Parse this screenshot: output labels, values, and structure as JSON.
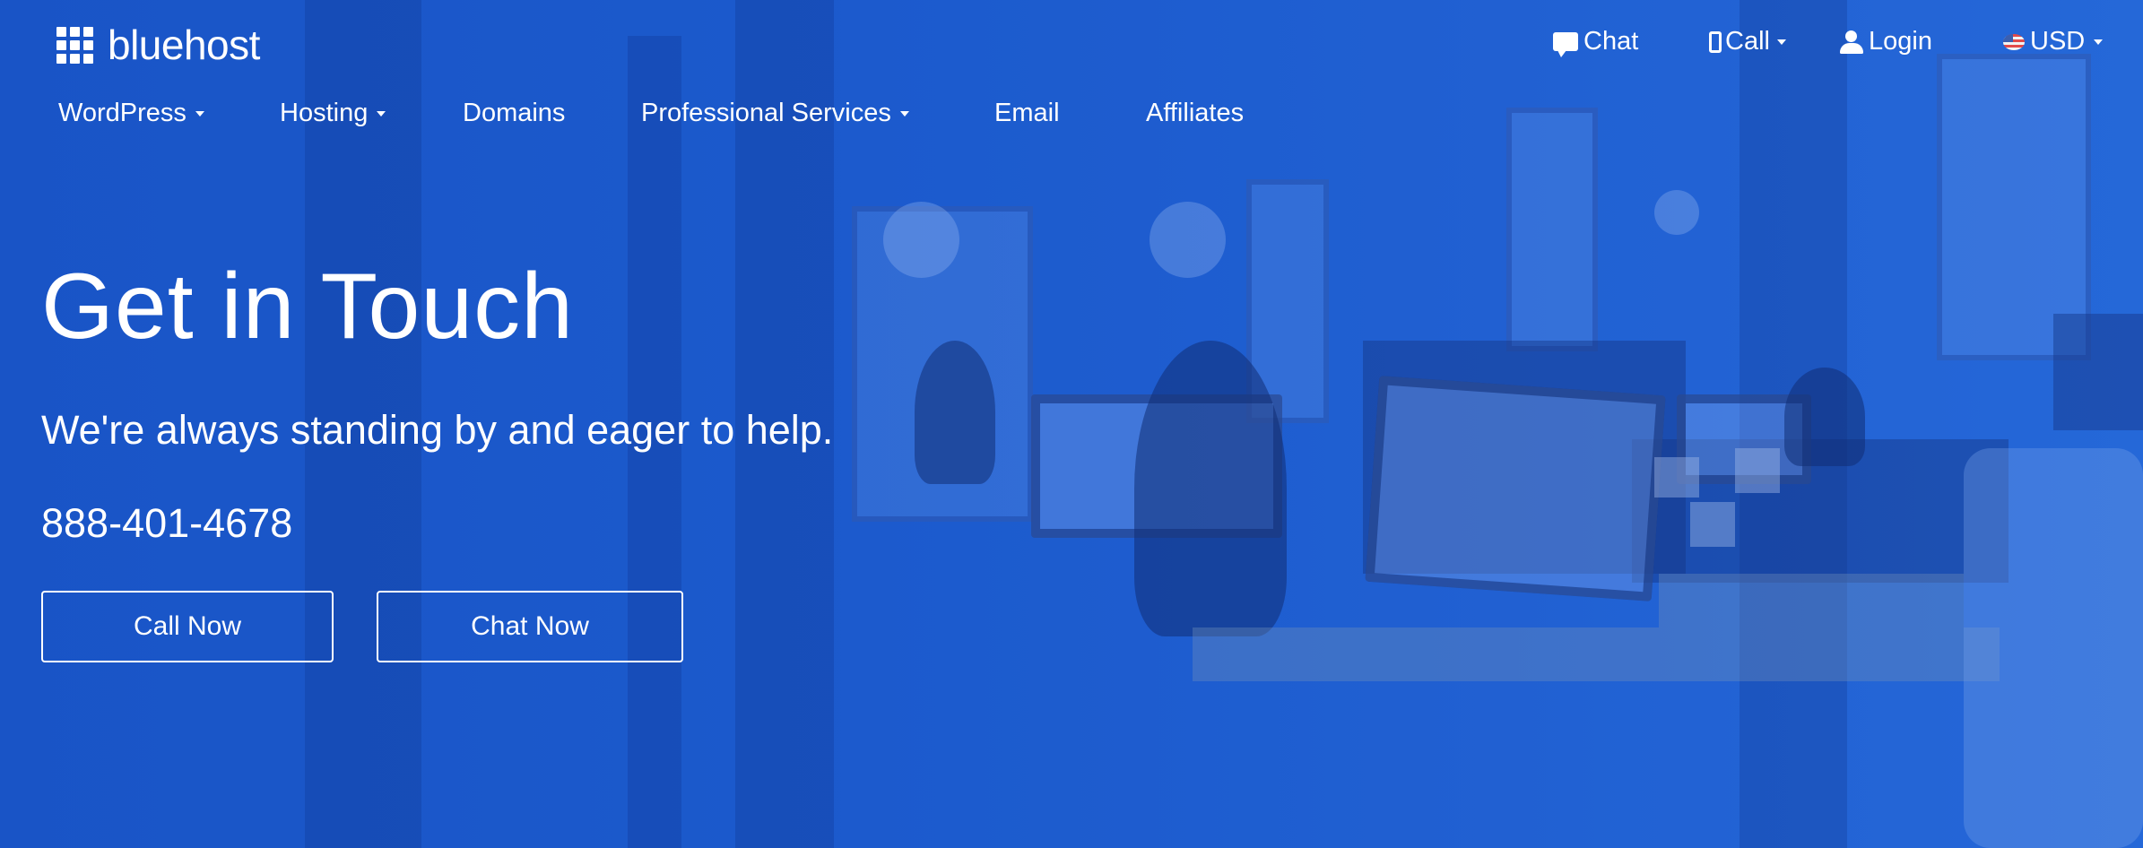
{
  "brand": {
    "name": "bluehost"
  },
  "utility_nav": {
    "chat": {
      "label": "Chat",
      "icon": "chat-bubble-icon"
    },
    "call": {
      "label": "Call",
      "icon": "phone-icon"
    },
    "login": {
      "label": "Login",
      "icon": "user-icon"
    },
    "currency": {
      "label": "USD",
      "icon": "us-flag-icon"
    }
  },
  "main_nav": {
    "wordpress": "WordPress",
    "hosting": "Hosting",
    "domains": "Domains",
    "professional_services": "Professional Services",
    "email": "Email",
    "affiliates": "Affiliates"
  },
  "hero": {
    "title": "Get in Touch",
    "subtitle": "We're always standing by and eager to help.",
    "phone": "888-401-4678",
    "call_button": "Call Now",
    "chat_button": "Chat Now"
  },
  "colors": {
    "hero_overlay": "#1e5fd0",
    "text": "#ffffff"
  }
}
